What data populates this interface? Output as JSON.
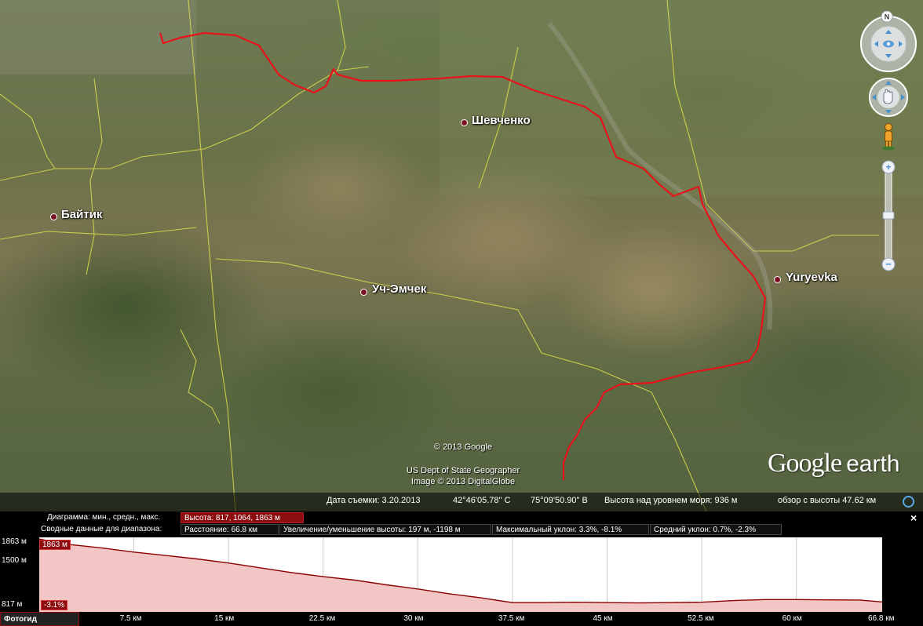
{
  "map": {
    "places": [
      {
        "id": "shevchenko",
        "name": "Шевченко"
      },
      {
        "id": "baitik",
        "name": "Байтик"
      },
      {
        "id": "uch-emchek",
        "name": "Уч-Эмчек"
      },
      {
        "id": "yuryevka",
        "name": "Yuryevka"
      }
    ],
    "credits": {
      "line1": "© 2013 Google",
      "line2": "US Dept of State Geographer",
      "line3": "Image © 2013 DigitalGlobe"
    },
    "logo": {
      "google": "Google",
      "earth": "earth"
    },
    "route_color": "#e8121b",
    "boundary_color": "#d6d84a",
    "compass_letter": "N"
  },
  "status": {
    "date": "Дата съемки: 3.20.2013",
    "lat": "42°46'05.78\" С",
    "lon": "75°09'50.90\" В",
    "elev": "Высота над уровнем моря:   936 м",
    "eye": "обзор с высоты  47.62 км"
  },
  "profile": {
    "row1_label": "Диаграмма: мин., средн., макс.",
    "row1_value": "Высота: 817, 1064, 1863 м",
    "row2_label": "Сводные данные для диапазона:",
    "stats": {
      "distance": "Расстояние: 66.8 км",
      "gain_loss": "Увеличение/уменьшение высоты: 197 м, -1198 м",
      "max_slope": "Максимальный уклон: 3.3%, -8.1%",
      "avg_slope": "Средний уклон: 0.7%, -2.3%"
    },
    "close_label": "×",
    "photo_button": "Фотогид",
    "max_badge": "1863 м",
    "slope_badge": "-3.1%"
  },
  "chart_data": {
    "type": "area",
    "x_unit": "км",
    "y_unit": "м",
    "y_ticks": [
      "1863 м",
      "1500 м",
      "817 м"
    ],
    "x_ticks": [
      "7.5 км",
      "15 км",
      "22.5 км",
      "30 км",
      "37.5 км",
      "45 км",
      "52.5 км",
      "60 км",
      "66.8 км"
    ],
    "ylim": [
      817,
      1863
    ],
    "xlim": [
      0,
      66.8
    ],
    "x": [
      0,
      2,
      5,
      7.5,
      10,
      12.5,
      15,
      17.5,
      20,
      22.5,
      25,
      27.5,
      30,
      32.5,
      35,
      37.5,
      40,
      42.5,
      45,
      47.5,
      50,
      52.5,
      55,
      57.5,
      60,
      62.5,
      65,
      66.8
    ],
    "y": [
      1863,
      1790,
      1730,
      1670,
      1620,
      1570,
      1510,
      1440,
      1370,
      1310,
      1260,
      1190,
      1130,
      1060,
      1000,
      930,
      930,
      935,
      930,
      925,
      930,
      935,
      960,
      975,
      975,
      970,
      968,
      940
    ],
    "fill_color": "#f3c6c6",
    "line_color": "#8b0000"
  }
}
